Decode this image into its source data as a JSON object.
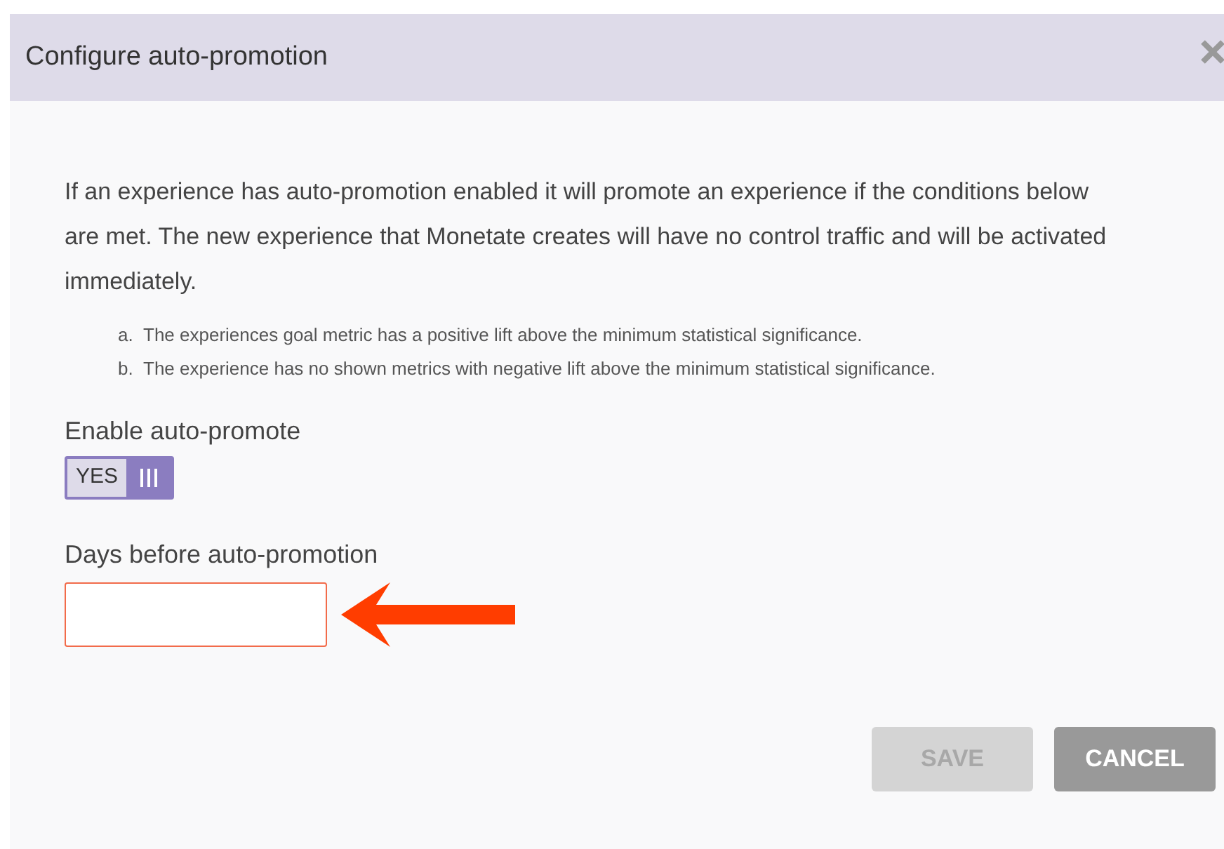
{
  "dialog": {
    "title": "Configure auto-promotion"
  },
  "intro": "If an experience has auto-promotion enabled it will promote an experience if the conditions below are met. The new experience that Monetate creates will have no control traffic and will be activated immediately.",
  "conditions": [
    {
      "marker": "a.",
      "text": "The experiences goal metric has a positive lift above the minimum statistical significance."
    },
    {
      "marker": "b.",
      "text": "The experience has no shown metrics with negative lift above the minimum statistical significance."
    }
  ],
  "enable_toggle": {
    "label": "Enable auto-promote",
    "state_text": "YES",
    "on": true
  },
  "days_field": {
    "label": "Days before auto-promotion",
    "highlighted": true
  },
  "buttons": [
    {
      "label": "SAVE",
      "disabled": true
    },
    {
      "label": "CANCEL",
      "disabled": false
    }
  ]
}
